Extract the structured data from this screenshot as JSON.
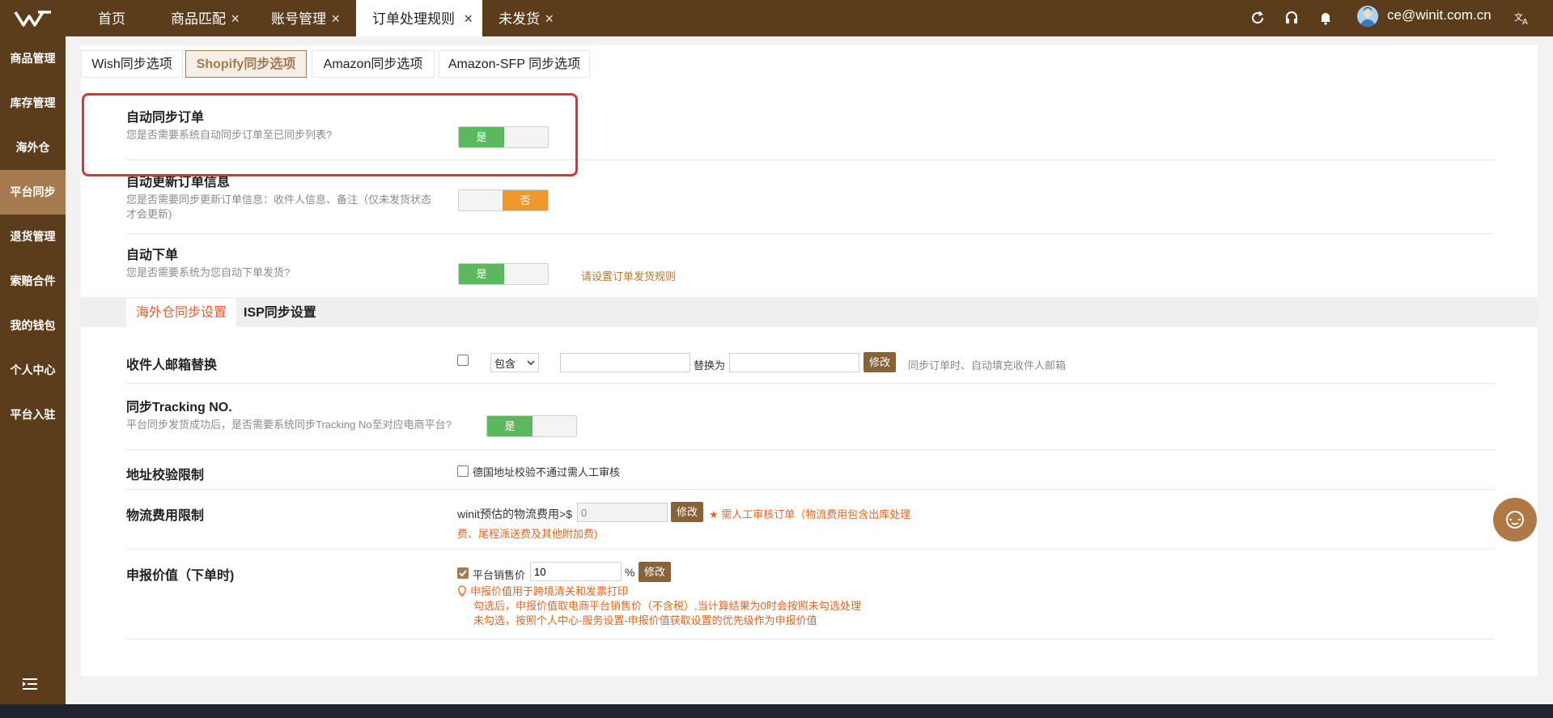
{
  "topbar": {
    "tabs": [
      {
        "label": "首页",
        "closable": false
      },
      {
        "label": "商品匹配",
        "closable": true
      },
      {
        "label": "账号管理",
        "closable": true
      },
      {
        "label": "订单处理规则",
        "closable": true,
        "active": true
      },
      {
        "label": "未发货",
        "closable": true
      }
    ],
    "user_email": "ce@winit.com.cn"
  },
  "sidebar": {
    "items": [
      {
        "label": "商品管理"
      },
      {
        "label": "库存管理"
      },
      {
        "label": "海外仓"
      },
      {
        "label": "平台同步",
        "active": true
      },
      {
        "label": "退货管理"
      },
      {
        "label": "索赔合件"
      },
      {
        "label": "我的钱包"
      },
      {
        "label": "个人中心"
      },
      {
        "label": "平台入驻"
      }
    ]
  },
  "sync_tabs": [
    {
      "label": "Wish同步选项"
    },
    {
      "label": "Shopify同步选项",
      "active": true
    },
    {
      "label": "Amazon同步选项"
    },
    {
      "label": "Amazon-SFP 同步选项"
    }
  ],
  "settings": {
    "auto_sync_order": {
      "title": "自动同步订单",
      "desc": "您是否需要系统自动同步订单至已同步列表?",
      "toggle_label": "是"
    },
    "auto_update_order": {
      "title": "自动更新订单信息",
      "desc_line1": "您是否需要同步更新订单信息：收件人信息、备注（仅未发货状态",
      "desc_line2": "才会更新)",
      "toggle_label": "否"
    },
    "auto_place_order": {
      "title": "自动下单",
      "desc": "您是否需要系统为您自动下单发货?",
      "toggle_label": "是",
      "link": "请设置订单发货规则"
    }
  },
  "sub_tabs": [
    {
      "label": "海外仓同步设置",
      "active": true
    },
    {
      "label": "ISP同步设置"
    }
  ],
  "warehouse": {
    "email_replace": {
      "title": "收件人邮箱替换",
      "select_value": "包含",
      "replace_label": "替换为",
      "button": "修改",
      "hint": "同步订单时、自动填充收件人邮箱"
    },
    "tracking": {
      "title": "同步Tracking NO.",
      "desc": "平台同步发货成功后，是否需要系统同步Tracking No至对应电商平台?",
      "toggle_label": "是"
    },
    "address_check": {
      "title": "地址校验限制",
      "checkbox_label": "德国地址校验不通过需人工审核"
    },
    "logistics_fee": {
      "title": "物流费用限制",
      "prefix": "winit预估的物流费用>$",
      "value": "0",
      "button": "修改",
      "note_line1": "需人工审核订单（物流费用包含出库处理",
      "note_line2": "费、尾程派送费及其他附加费)"
    },
    "declared_value": {
      "title": "申报价值（下单时)",
      "checkbox_label": "平台销售价",
      "value": "10",
      "unit": "%",
      "button": "修改",
      "note_line1": "申报价值用于跨境清关和发票打印",
      "note_line2": "勾选后，申报价值取电商平台销售价（不含税）,当计算结果为0时会按照未勾选处理",
      "note_line3": "未勾选，按照个人中心-服务设置-申报价值获取设置的优先级作为申报价值"
    }
  },
  "colors": {
    "brand_dark": "#5b3d1c",
    "brand_accent": "#a47a4e",
    "toggle_on": "#5cb85c",
    "toggle_off": "#f0962a",
    "highlight_border": "#e0303a"
  }
}
